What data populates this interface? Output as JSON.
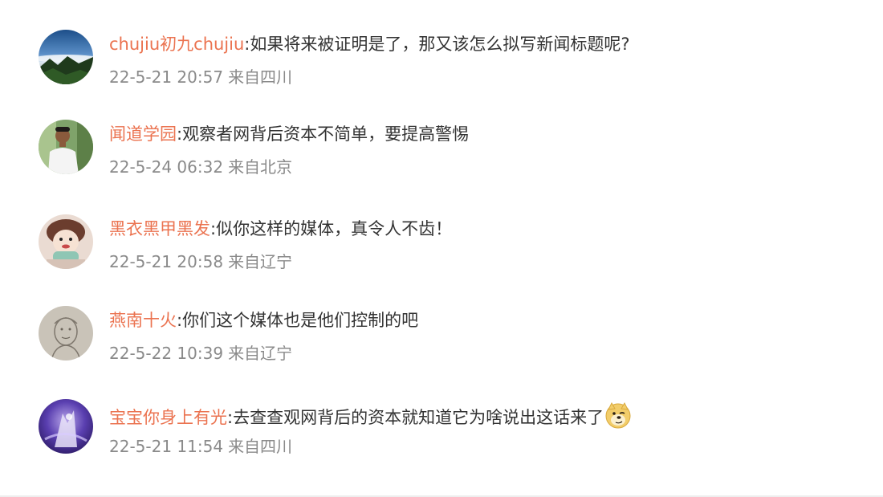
{
  "comments": [
    {
      "user": "chujiu初九chujiu",
      "separator": ":",
      "text": "如果将来被证明是了，那又该怎么拟写新闻标题呢?",
      "time": "22-5-21 20:57",
      "location": "来自四川",
      "avatar_icon": "landscape-avatar"
    },
    {
      "user": "闻道学园",
      "separator": ":",
      "text": "观察者网背后资本不简单，要提高警惕",
      "time": "22-5-24 06:32",
      "location": "来自北京",
      "avatar_icon": "person-avatar"
    },
    {
      "user": "黑衣黑甲黑发",
      "separator": ":",
      "text": "似你这样的媒体，真令人不齿！",
      "time": "22-5-21 20:58",
      "location": "来自辽宁",
      "avatar_icon": "doll-avatar"
    },
    {
      "user": "燕南十火",
      "separator": ":",
      "text": "你们这个媒体也是他们控制的吧",
      "time": "22-5-22 10:39",
      "location": "来自辽宁",
      "avatar_icon": "sketch-avatar"
    },
    {
      "user": "宝宝你身上有光",
      "separator": ":",
      "text": "去查查观网背后的资本就知道它为啥说出这话来了",
      "time": "22-5-21 11:54",
      "location": "来自四川",
      "avatar_icon": "purple-art-avatar",
      "emoji_icon": "doge-emoji-icon"
    }
  ],
  "colors": {
    "username": "#eb7350",
    "text": "#333333",
    "meta": "#8a8a8a"
  }
}
